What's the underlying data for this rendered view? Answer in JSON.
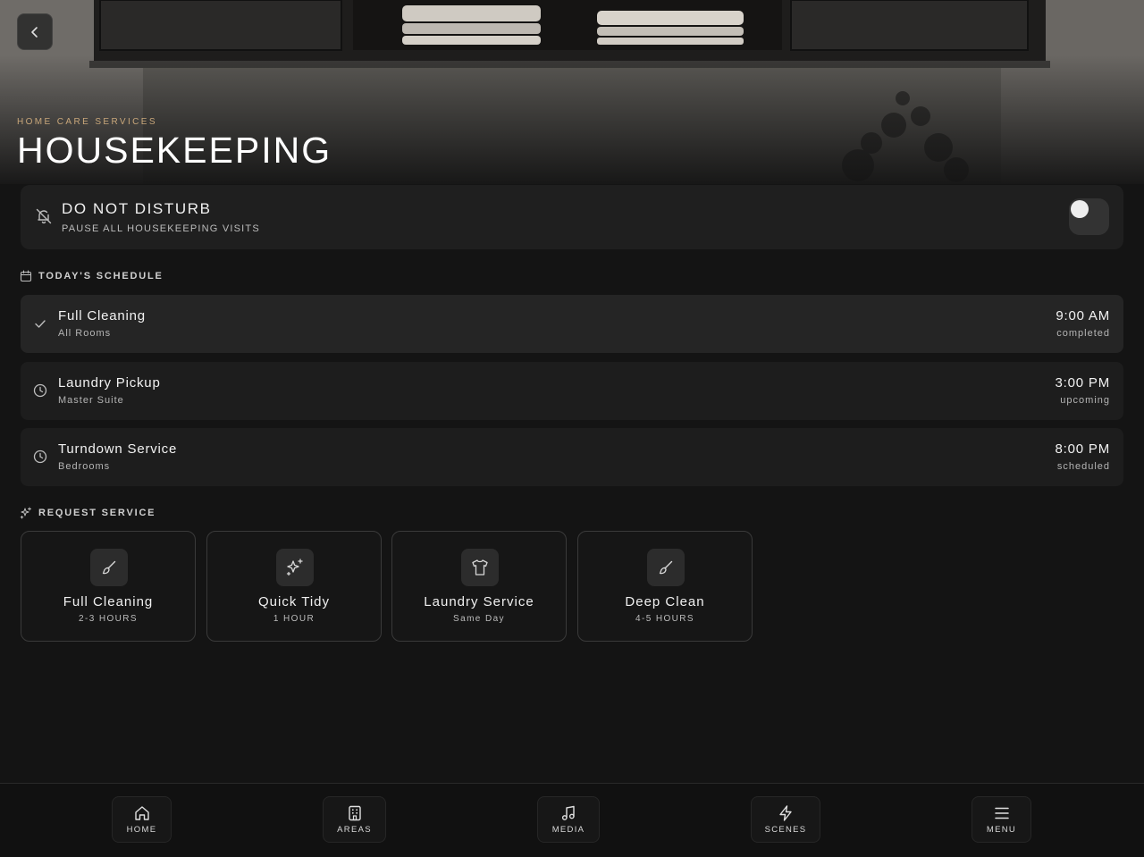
{
  "header": {
    "eyebrow": "HOME CARE SERVICES",
    "title": "HOUSEKEEPING"
  },
  "dnd": {
    "title": "DO NOT DISTURB",
    "subtitle": "PAUSE ALL HOUSEKEEPING VISITS",
    "enabled": false
  },
  "schedule": {
    "heading": "TODAY'S SCHEDULE",
    "items": [
      {
        "name": "Full Cleaning",
        "location": "All Rooms",
        "time": "9:00 AM",
        "status": "completed",
        "icon": "check-icon"
      },
      {
        "name": "Laundry Pickup",
        "location": "Master Suite",
        "time": "3:00 PM",
        "status": "upcoming",
        "icon": "clock-icon"
      },
      {
        "name": "Turndown Service",
        "location": "Bedrooms",
        "time": "8:00 PM",
        "status": "scheduled",
        "icon": "clock-icon"
      }
    ]
  },
  "request": {
    "heading": "REQUEST SERVICE",
    "services": [
      {
        "name": "Full Cleaning",
        "duration": "2-3 HOURS",
        "icon": "brush-icon"
      },
      {
        "name": "Quick Tidy",
        "duration": "1 HOUR",
        "icon": "sparkles-icon"
      },
      {
        "name": "Laundry Service",
        "duration": "Same Day",
        "icon": "shirt-icon"
      },
      {
        "name": "Deep Clean",
        "duration": "4-5 HOURS",
        "icon": "brush-icon"
      }
    ]
  },
  "nav": {
    "items": [
      {
        "label": "HOME",
        "icon": "home-icon"
      },
      {
        "label": "AREAS",
        "icon": "building-icon"
      },
      {
        "label": "MEDIA",
        "icon": "music-icon"
      },
      {
        "label": "SCENES",
        "icon": "lightning-icon"
      },
      {
        "label": "MENU",
        "icon": "hamburger-menu-icon"
      }
    ]
  },
  "colors": {
    "accent": "#c9a77a",
    "background": "#141414",
    "card": "#1f1f1f"
  }
}
